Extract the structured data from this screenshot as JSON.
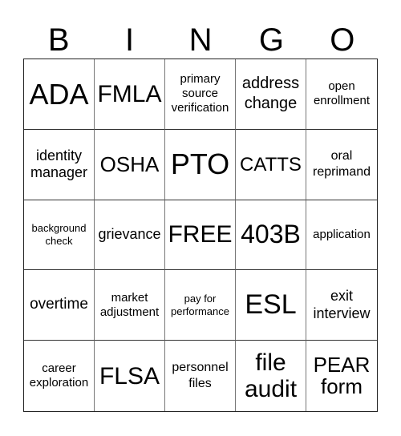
{
  "header": [
    "B",
    "I",
    "N",
    "G",
    "O"
  ],
  "cells": [
    "ADA",
    "FMLA",
    "primary source verification",
    "address change",
    "open enrollment",
    "identity manager",
    "OSHA",
    "PTO",
    "CATTS",
    "oral reprimand",
    "background check",
    "grievance",
    "FREE",
    "403B",
    "application",
    "overtime",
    "market adjustment",
    "pay for performance",
    "ESL",
    "exit interview",
    "career exploration",
    "FLSA",
    "personnel files",
    "file audit",
    "PEAR form"
  ]
}
